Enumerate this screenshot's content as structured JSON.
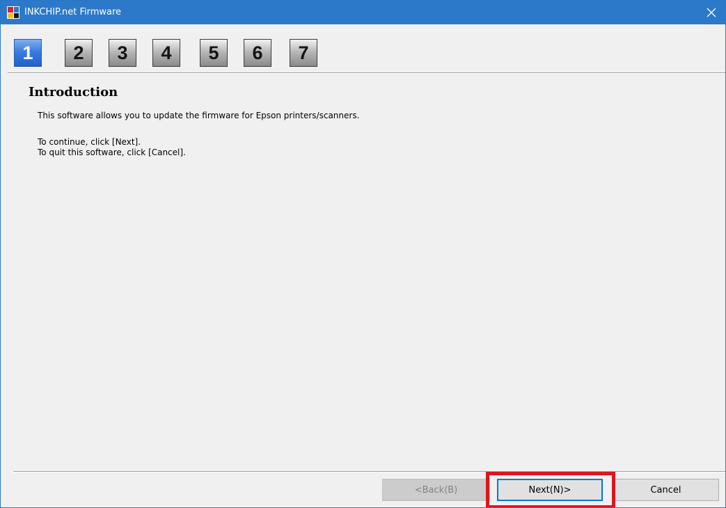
{
  "window": {
    "title": "INKCHIP.net Firmware",
    "app_icon_colors": [
      "#e2202a",
      "#2b79c8",
      "#f3c400",
      "#1a1a1a"
    ],
    "close_glyph": "×",
    "close_icon": "close-icon"
  },
  "steps": {
    "items": [
      {
        "label": "1",
        "active": true
      },
      {
        "label": "2",
        "active": false
      },
      {
        "label": "3",
        "active": false
      },
      {
        "label": "4",
        "active": false
      },
      {
        "label": "5",
        "active": false
      },
      {
        "label": "6",
        "active": false
      },
      {
        "label": "7",
        "active": false
      }
    ]
  },
  "content": {
    "title": "Introduction",
    "description": "This software allows you to update the firmware for Epson printers/scanners.",
    "instruction_continue": "To continue, click [Next].",
    "instruction_quit": "To quit this software, click [Cancel]."
  },
  "buttons": {
    "back_label": "<Back(B)",
    "back_disabled": true,
    "next_label": "Next(N)>",
    "cancel_label": "Cancel"
  },
  "colors": {
    "titlebar": "#2b79c8",
    "step_active": "#3a7de0",
    "highlight": "#e0141e",
    "default_button_border": "#0078d7"
  }
}
